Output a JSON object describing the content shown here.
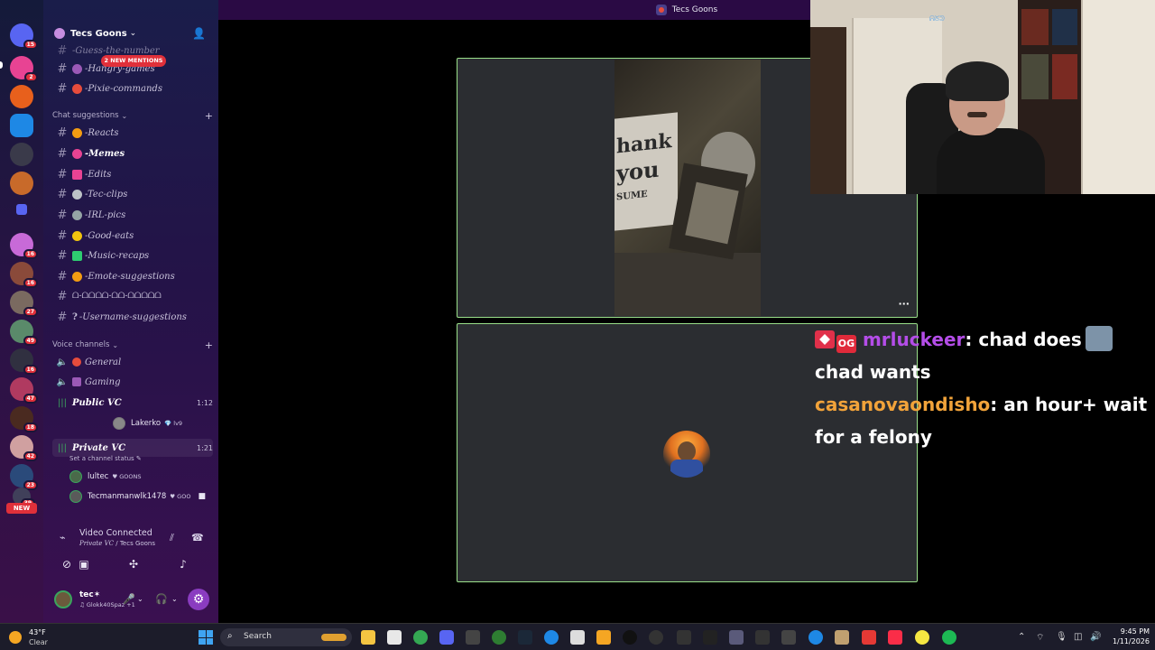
{
  "window": {
    "title": "Tecs Goons"
  },
  "server": {
    "name": "Tecs Goons",
    "mentions_label": "2 NEW MENTIONS"
  },
  "rail": {
    "badges": [
      "15",
      "2",
      "16",
      "16",
      "27",
      "49",
      "16",
      "47",
      "18",
      "42",
      "23",
      "39"
    ],
    "new_label": "NEW"
  },
  "channels_top": [
    {
      "name": "-Guess-the-number",
      "emoji_color": "#f1c40f"
    },
    {
      "name": "-Hangry-games",
      "emoji_color": "#9b59b6"
    },
    {
      "name": "-Pixie-commands",
      "emoji_color": "#e74c3c"
    }
  ],
  "chat_category": "Chat suggestions",
  "chat_channels": [
    {
      "name": "-Reacts",
      "emoji_color": "#f39c12"
    },
    {
      "name": "-Memes",
      "emoji_color": "#e84393",
      "active": true
    },
    {
      "name": "-Edits",
      "emoji_color": "#e84393"
    },
    {
      "name": "-Tec-clips",
      "emoji_color": "#bdc3c7"
    },
    {
      "name": "-IRL-pics",
      "emoji_color": "#95a5a6"
    },
    {
      "name": "-Good-eats",
      "emoji_color": "#f1c40f"
    },
    {
      "name": "-Music-recaps",
      "emoji_color": "#2ecc71"
    },
    {
      "name": "-Emote-suggestions",
      "emoji_color": "#f39c12"
    },
    {
      "name": "ᗝ-ᗝᗝᗝᗝ-ᗝᗝ-ᗝᗝᗝᗝᗝ",
      "emoji_color": ""
    },
    {
      "name": "-Username-suggestions",
      "emoji_color": "#ffffff",
      "prefix": "?"
    }
  ],
  "voice_category": "Voice channels",
  "voice_channels": [
    {
      "name": "General",
      "time": ""
    },
    {
      "name": "Gaming",
      "time": ""
    },
    {
      "name": "Public VC",
      "time": "1:12"
    },
    {
      "name": "Private VC",
      "time": "1:21"
    }
  ],
  "public_vc_user": {
    "name": "Lakerko",
    "tag": "💎 lv9"
  },
  "private_vc": {
    "status": "Set a channel status ✎",
    "users": [
      {
        "name": "lultec",
        "tag": "♥ GOONS"
      },
      {
        "name": "Tecmanmanwlk1478",
        "tag": "♥ GOO"
      }
    ]
  },
  "voice_connection": {
    "status": "Video Connected",
    "channel": "Private VC",
    "server": "Tecs Goons"
  },
  "user": {
    "name": "tec✶",
    "status": "♫ Glokk40Spaz +1"
  },
  "chat": {
    "messages": [
      {
        "badge2": "OG",
        "user": "mrluckeer",
        "text": "chad does",
        "text2": "chad wants",
        "name_color": "#b44de8"
      },
      {
        "user": "casanovaondisho",
        "text": "an hour+ wait",
        "text2": "for a felony",
        "name_color": "#f2a33a"
      }
    ]
  },
  "video": {
    "sign_line1": "hank",
    "sign_line2": "you",
    "sign_line3": "SUME"
  },
  "cam": {
    "watermark": "ᕱᘜᕲ"
  },
  "taskbar": {
    "temp": "43°F",
    "condition": "Clear",
    "search_placeholder": "Search",
    "time": "9:45 PM",
    "date": "1/11/2026"
  }
}
